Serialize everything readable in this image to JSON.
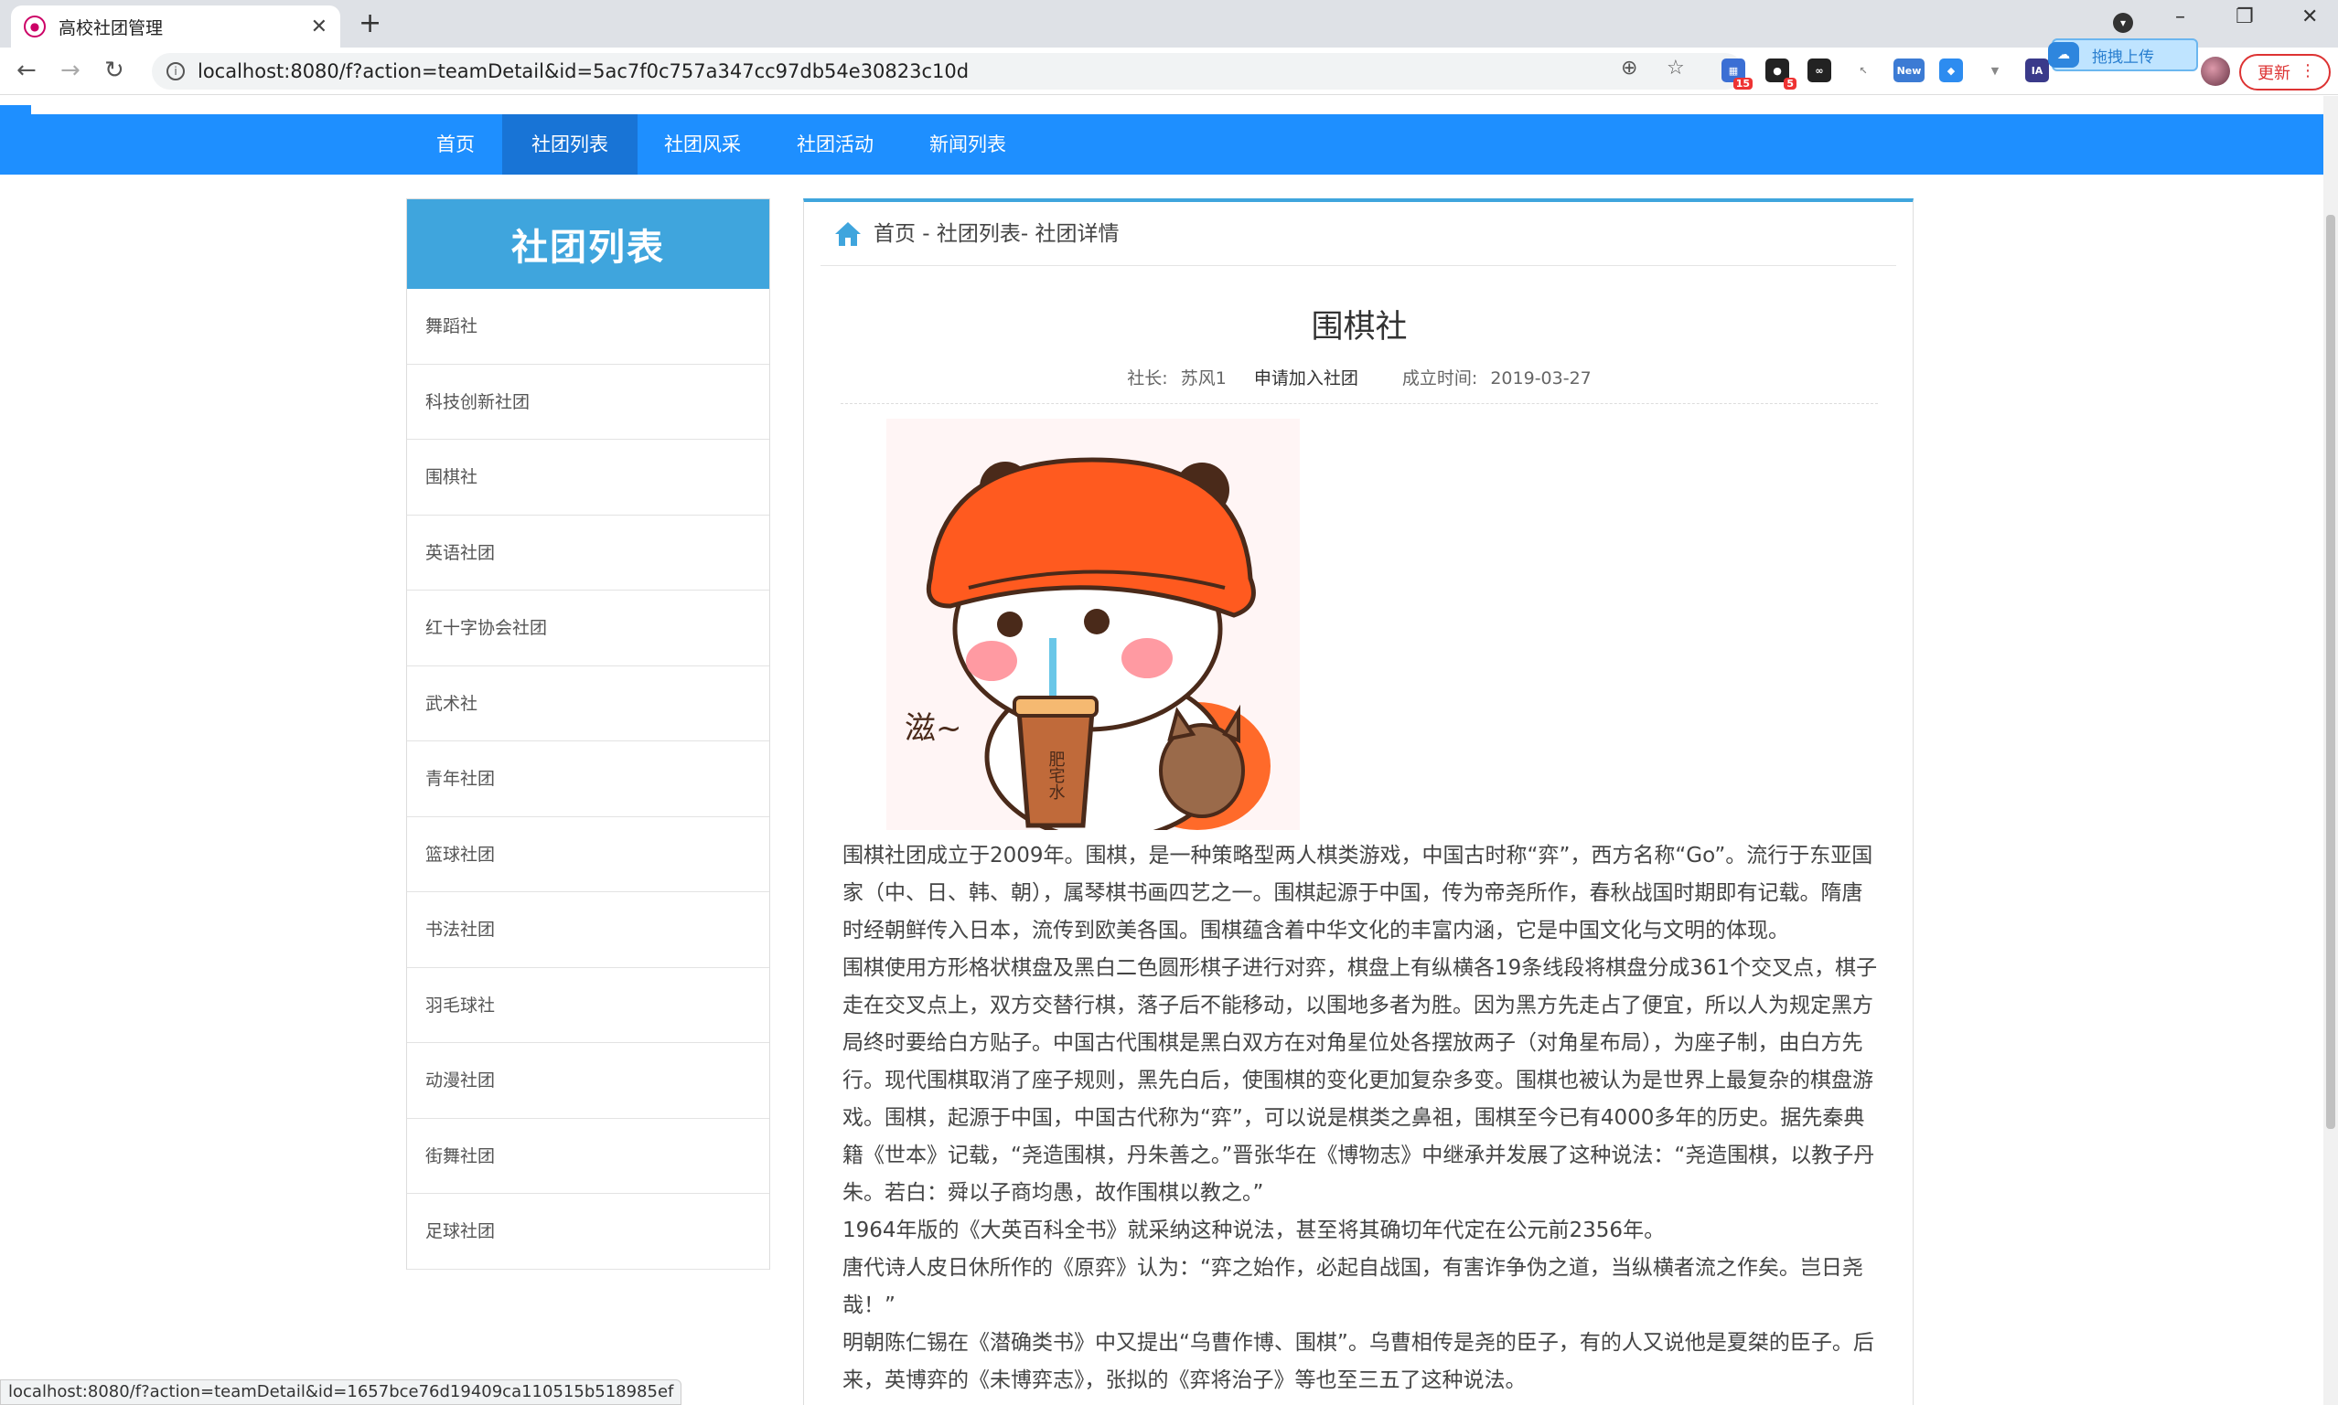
{
  "browser": {
    "tab_title": "高校社团管理",
    "url": "localhost:8080/f?action=teamDetail&id=5ac7f0c757a347cc97db54e30823c10d",
    "ext_badge_1": "15",
    "ext_badge_2": "5",
    "ext_new": "New",
    "upload_label": "拖拽上传",
    "update_label": "更新",
    "status_url": "localhost:8080/f?action=teamDetail&id=1657bce76d19409ca110515b518985ef"
  },
  "nav": {
    "items": [
      "首页",
      "社团列表",
      "社团风采",
      "社团活动",
      "新闻列表"
    ],
    "active_index": 1
  },
  "sidebar": {
    "title": "社团列表",
    "items": [
      "舞蹈社",
      "科技创新社团",
      "围棋社",
      "英语社团",
      "红十字协会社团",
      "武术社",
      "青年社团",
      "篮球社团",
      "书法社团",
      "羽毛球社",
      "动漫社团",
      "街舞社团",
      "足球社团"
    ]
  },
  "content": {
    "breadcrumb": "首页 - 社团列表- 社团详情",
    "title": "围棋社",
    "leader_label": "社长:",
    "leader_name": "苏风1",
    "join_link": "申请加入社团",
    "founded_label": "成立时间:",
    "founded_date": "2019-03-27",
    "image_text": "滋~",
    "cup_text": "肥宅水",
    "paragraphs": [
      "围棋社团成立于2009年。围棋，是一种策略型两人棋类游戏，中国古时称“弈”，西方名称“Go”。流行于东亚国家（中、日、韩、朝），属琴棋书画四艺之一。围棋起源于中国，传为帝尧所作，春秋战国时期即有记载。隋唐时经朝鲜传入日本，流传到欧美各国。围棋蕴含着中华文化的丰富内涵，它是中国文化与文明的体现。",
      "围棋使用方形格状棋盘及黑白二色圆形棋子进行对弈，棋盘上有纵横各19条线段将棋盘分成361个交叉点，棋子走在交叉点上，双方交替行棋，落子后不能移动，以围地多者为胜。因为黑方先走占了便宜，所以人为规定黑方局终时要给白方贴子。中国古代围棋是黑白双方在对角星位处各摆放两子（对角星布局），为座子制，由白方先行。现代围棋取消了座子规则，黑先白后，使围棋的变化更加复杂多变。围棋也被认为是世界上最复杂的棋盘游戏。围棋，起源于中国，中国古代称为“弈”，可以说是棋类之鼻祖，围棋至今已有4000多年的历史。据先秦典籍《世本》记载，“尧造围棋，丹朱善之。”晋张华在《博物志》中继承并发展了这种说法：“尧造围棋，以教子丹朱。若白：舜以子商均愚，故作围棋以教之。”",
      "1964年版的《大英百科全书》就采纳这种说法，甚至将其确切年代定在公元前2356年。",
      "唐代诗人皮日休所作的《原弈》认为：“弈之始作，必起自战国，有害诈争伪之道，当纵横者流之作矣。岂日尧哉！”",
      "明朝陈仁锡在《潜确类书》中又提出“乌曹作博、围棋”。乌曹相传是尧的臣子，有的人又说他是夏桀的臣子。后来，英博弈的《未博弈志》，张拟的《弈将治子》等也至三五了这种说法。"
    ]
  }
}
